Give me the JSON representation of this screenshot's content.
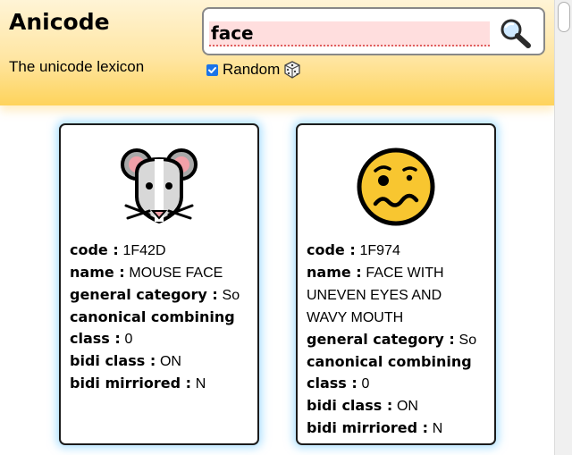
{
  "header": {
    "title": "Anicode",
    "subtitle": "The unicode lexicon"
  },
  "search": {
    "value": "face",
    "button_icon": "magnifier-icon"
  },
  "random": {
    "checked": true,
    "label": "Random",
    "icon": "dice-icon"
  },
  "labels": {
    "code": "code :",
    "name": "name :",
    "general_category": "general category :",
    "canonical_combining_class": "canonical combining class :",
    "bidi_class": "bidi class :",
    "bidi_mirrored": "bidi mirriored :"
  },
  "cards": [
    {
      "emoji_icon": "mouse-face-icon",
      "code": "1F42D",
      "name": "MOUSE FACE",
      "general_category": "So",
      "canonical_combining_class": "0",
      "bidi_class": "ON",
      "bidi_mirrored": "N"
    },
    {
      "emoji_icon": "face-with-uneven-eyes-and-wavy-mouth-icon",
      "code": "1F974",
      "name": "FACE WITH UNEVEN EYES AND WAVY MOUTH",
      "general_category": "So",
      "canonical_combining_class": "0",
      "bidi_class": "ON",
      "bidi_mirrored": "N"
    }
  ],
  "colors": {
    "header_top": "#fff4d6",
    "header_bottom": "#fed35b",
    "search_field_bg": "#ffdede",
    "card_glow": "#78cdff",
    "checkbox_accent": "#1a73e8"
  }
}
